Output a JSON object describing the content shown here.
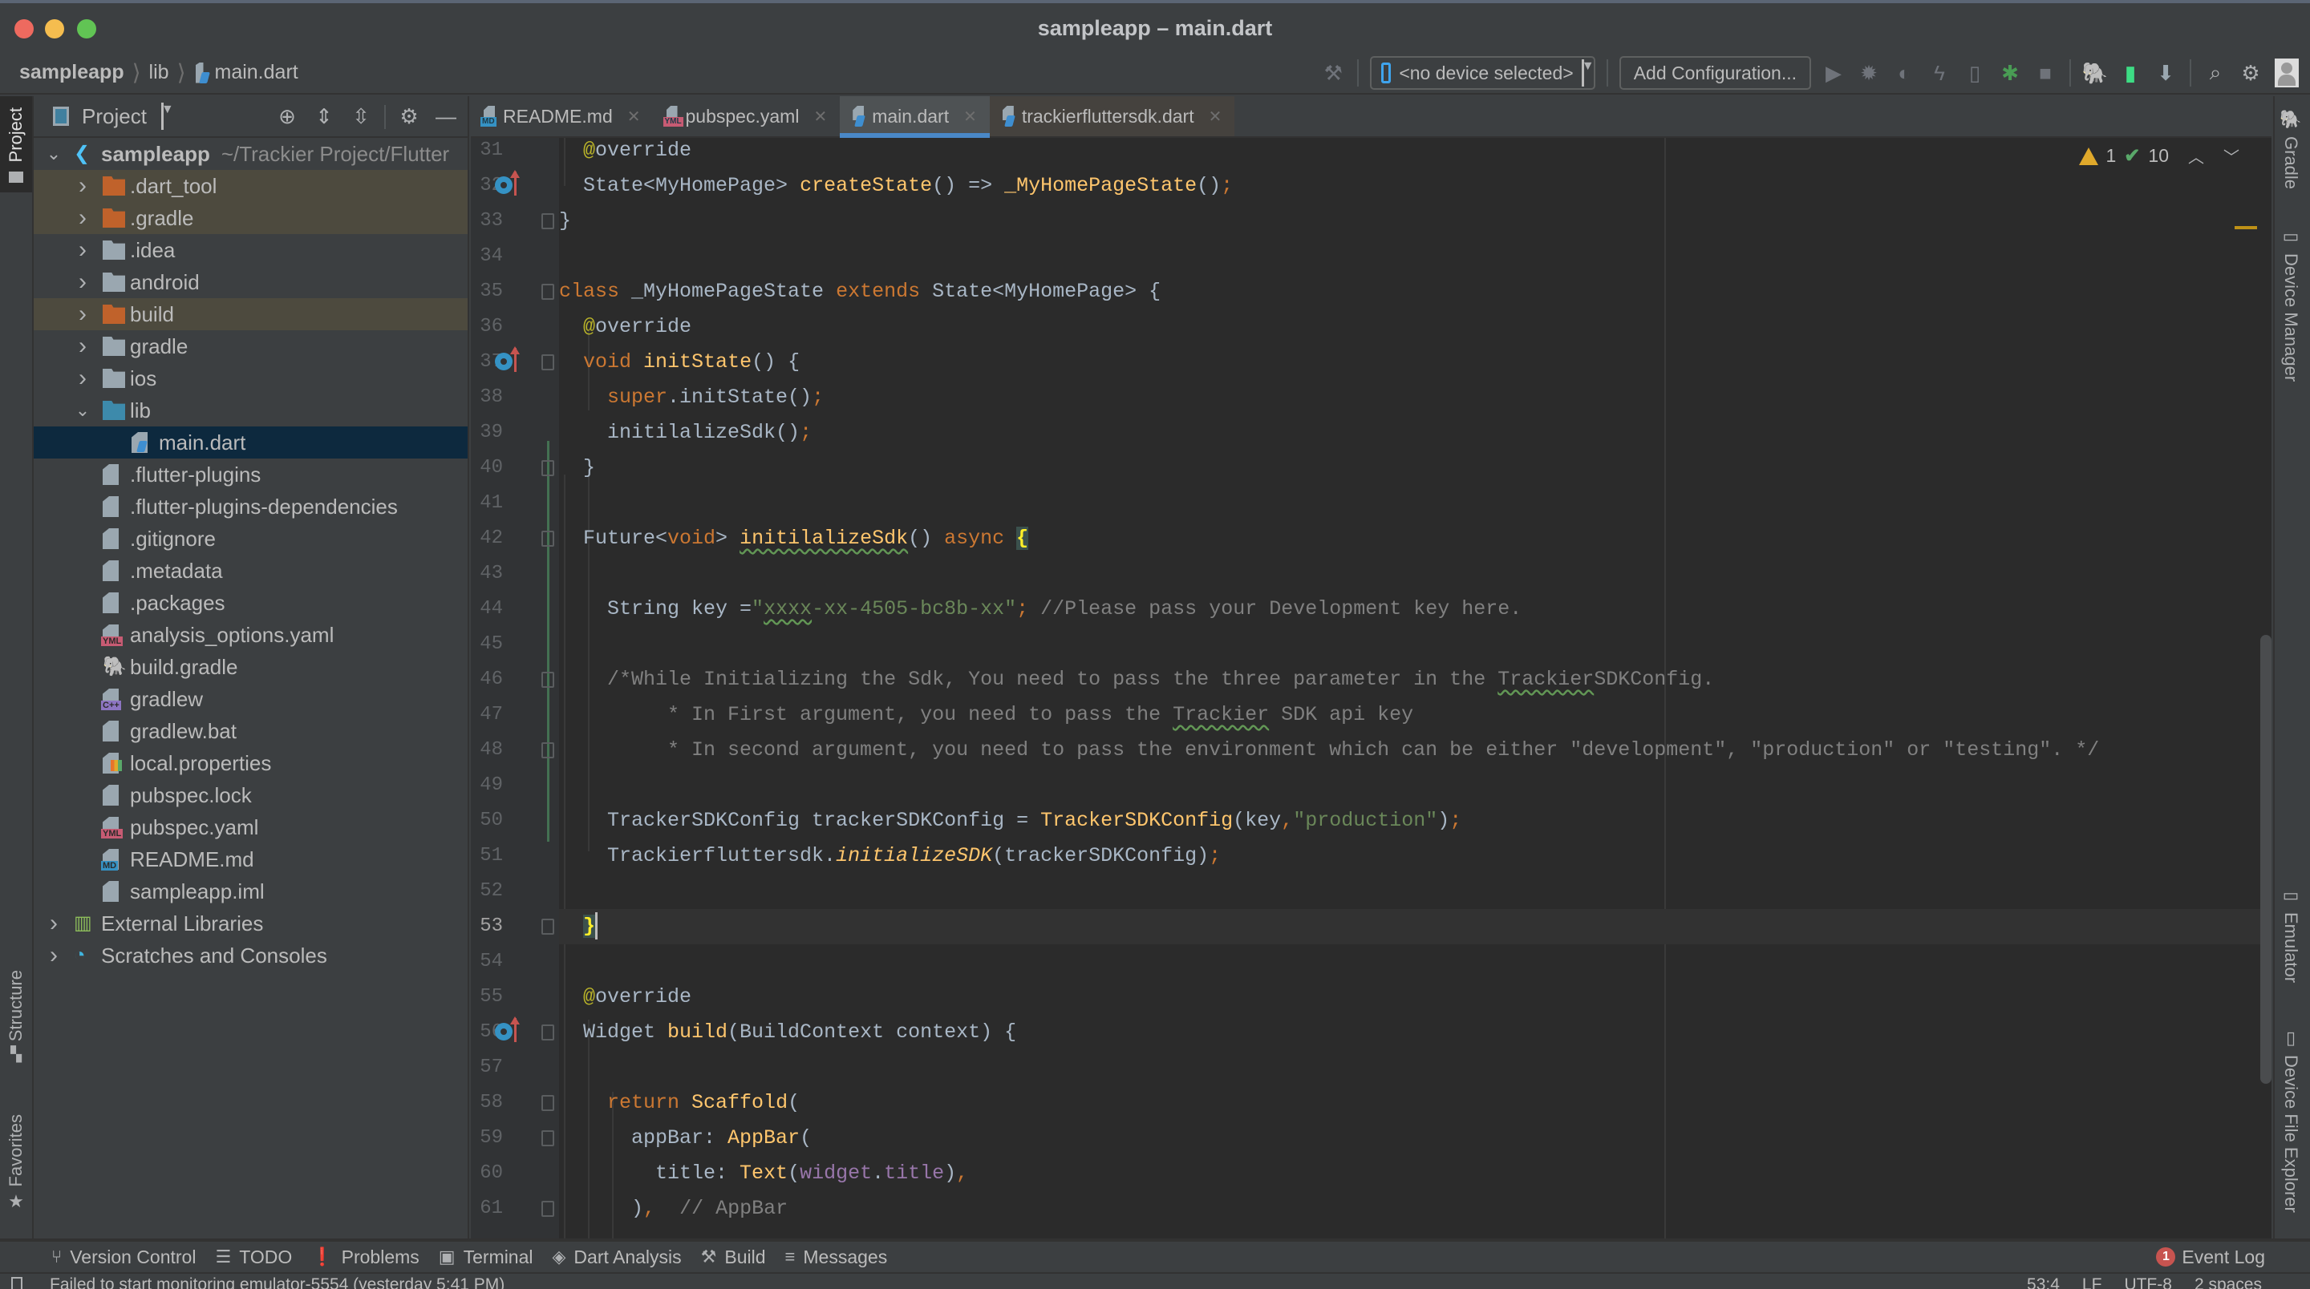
{
  "window": {
    "title": "sampleapp – main.dart"
  },
  "navbar": {
    "breadcrumb": [
      "sampleapp",
      "lib",
      "main.dart"
    ],
    "device_selector": "<no device selected>",
    "add_configuration": "Add Configuration...",
    "toolbar_icons": [
      "hammer-icon",
      "run-icon",
      "debug-icon",
      "profile-icon",
      "apply-changes-icon",
      "attach-debugger-icon",
      "flutter-inspector-icon",
      "stop-icon",
      "gradle-sync-icon",
      "avd-manager-icon",
      "sdk-manager-icon",
      "search-icon",
      "settings-icon",
      "account-icon"
    ]
  },
  "project_panel": {
    "title": "Project",
    "tree": [
      {
        "label": "sampleapp",
        "path": "~/Trackier Project/Flutter",
        "depth": 0,
        "expanded": true,
        "icon": "flutter-icon",
        "bold": true
      },
      {
        "label": ".dart_tool",
        "depth": 1,
        "expanded": false,
        "icon": "folder-excluded",
        "excluded": true
      },
      {
        "label": ".gradle",
        "depth": 1,
        "expanded": false,
        "icon": "folder-excluded",
        "excluded": true
      },
      {
        "label": ".idea",
        "depth": 1,
        "expanded": false,
        "icon": "folder-config"
      },
      {
        "label": "android",
        "depth": 1,
        "expanded": false,
        "icon": "folder-module"
      },
      {
        "label": "build",
        "depth": 1,
        "expanded": false,
        "icon": "folder-excluded-config",
        "excluded": true
      },
      {
        "label": "gradle",
        "depth": 1,
        "expanded": false,
        "icon": "folder"
      },
      {
        "label": "ios",
        "depth": 1,
        "expanded": false,
        "icon": "folder-module"
      },
      {
        "label": "lib",
        "depth": 1,
        "expanded": true,
        "icon": "folder-source"
      },
      {
        "label": "main.dart",
        "depth": 2,
        "icon": "dart-file",
        "selected": true
      },
      {
        "label": ".flutter-plugins",
        "depth": 1,
        "icon": "text-file"
      },
      {
        "label": ".flutter-plugins-dependencies",
        "depth": 1,
        "icon": "text-file"
      },
      {
        "label": ".gitignore",
        "depth": 1,
        "icon": "ignore-file"
      },
      {
        "label": ".metadata",
        "depth": 1,
        "icon": "text-file"
      },
      {
        "label": ".packages",
        "depth": 1,
        "icon": "text-file"
      },
      {
        "label": "analysis_options.yaml",
        "depth": 1,
        "icon": "yaml-file"
      },
      {
        "label": "build.gradle",
        "depth": 1,
        "icon": "gradle-file"
      },
      {
        "label": "gradlew",
        "depth": 1,
        "icon": "cpp-file"
      },
      {
        "label": "gradlew.bat",
        "depth": 1,
        "icon": "text-file"
      },
      {
        "label": "local.properties",
        "depth": 1,
        "icon": "properties-file"
      },
      {
        "label": "pubspec.lock",
        "depth": 1,
        "icon": "text-file"
      },
      {
        "label": "pubspec.yaml",
        "depth": 1,
        "icon": "yaml-file"
      },
      {
        "label": "README.md",
        "depth": 1,
        "icon": "markdown-file"
      },
      {
        "label": "sampleapp.iml",
        "depth": 1,
        "icon": "iml-file"
      },
      {
        "label": "External Libraries",
        "depth": 0,
        "expanded": false,
        "icon": "libraries-icon"
      },
      {
        "label": "Scratches and Consoles",
        "depth": 0,
        "expanded": false,
        "icon": "scratches-icon"
      }
    ]
  },
  "left_strip": {
    "project": "Project",
    "structure": "Structure",
    "favorites": "Favorites"
  },
  "right_strip": {
    "gradle": "Gradle",
    "device_manager": "Device Manager",
    "emulator": "Emulator",
    "device_file_explorer": "Device File Explorer"
  },
  "tabs": [
    {
      "label": "README.md",
      "icon": "markdown-file",
      "badge": "MD",
      "active": false
    },
    {
      "label": "pubspec.yaml",
      "icon": "yaml-file",
      "badge": "YML",
      "active": false
    },
    {
      "label": "main.dart",
      "icon": "dart-file",
      "active": true
    },
    {
      "label": "trackierfluttersdk.dart",
      "icon": "dart-file",
      "active": false,
      "pinned": true
    }
  ],
  "editor": {
    "inspection": {
      "warnings": "1",
      "weak_warnings": "10"
    },
    "cursor_line": 53,
    "lines": [
      {
        "n": "31",
        "code": "  <span class=\"an\">@</span>override"
      },
      {
        "n": "32",
        "code": "  State&lt;MyHomePage&gt; <span class=\"fn\">createState</span>() =&gt; <span class=\"fn\">_MyHomePageState</span>()<span class=\"sc\">;</span>",
        "override": true
      },
      {
        "n": "33",
        "code": "}",
        "fold": true
      },
      {
        "n": "34",
        "code": ""
      },
      {
        "n": "35",
        "code": "<span class=\"kw\">class</span> _MyHomePageState <span class=\"kw\">extends</span> State&lt;MyHomePage&gt; {",
        "fold": true
      },
      {
        "n": "36",
        "code": "  <span class=\"an\">@</span>override"
      },
      {
        "n": "37",
        "code": "  <span class=\"kw\">void</span> <span class=\"fn\">initState</span>() {",
        "override": true,
        "fold": true
      },
      {
        "n": "38",
        "code": "    <span class=\"kw\">super</span>.initState()<span class=\"sc\">;</span>"
      },
      {
        "n": "39",
        "code": "    initilalizeSdk()<span class=\"sc\">;</span>"
      },
      {
        "n": "40",
        "code": "  }",
        "fold": true
      },
      {
        "n": "41",
        "code": ""
      },
      {
        "n": "42",
        "code": "  Future&lt;<span class=\"kw\">void</span>&gt; <span class=\"fn wavy\">initilalizeSdk</span>() <span class=\"kw\">async</span> <span class=\"brace-hl\">{</span>",
        "fold": true
      },
      {
        "n": "43",
        "code": ""
      },
      {
        "n": "44",
        "code": "    String key =<span class=\"st\">\"<span class=\"wavy\">xxxx</span>-xx-4505-bc8b-xx\"</span><span class=\"sc\">;</span> <span class=\"cm\">//Please pass your Development key here.</span>"
      },
      {
        "n": "45",
        "code": ""
      },
      {
        "n": "46",
        "code": "    <span class=\"cm\">/*While Initializing the Sdk, You need to pass the three parameter in the <span class=\"wavy\">Trackier</span>SDKConfig.</span>",
        "fold": true
      },
      {
        "n": "47",
        "code": "<span class=\"cm\">         * In First argument, you need to pass the <span class=\"wavy\">Trackier</span> SDK api key</span>"
      },
      {
        "n": "48",
        "code": "<span class=\"cm\">         * In second argument, you need to pass the environment which can be either \"development\", \"production\" or \"testing\". */</span>",
        "fold": true
      },
      {
        "n": "49",
        "code": ""
      },
      {
        "n": "50",
        "code": "    TrackerSDKConfig trackerSDKConfig = <span class=\"fn\">TrackerSDKConfig</span>(key<span class=\"sc\">,</span><span class=\"st\">\"production\"</span>)<span class=\"sc\">;</span>"
      },
      {
        "n": "51",
        "code": "    Trackierfluttersdk.<span class=\"fn it\">initializeSDK</span>(trackerSDKConfig)<span class=\"sc\">;</span>"
      },
      {
        "n": "52",
        "code": ""
      },
      {
        "n": "53",
        "code": "  <span class=\"brace-hl\">}</span><span class=\"caret\"></span>",
        "fold": true
      },
      {
        "n": "54",
        "code": ""
      },
      {
        "n": "55",
        "code": "  <span class=\"an\">@</span>override"
      },
      {
        "n": "56",
        "code": "  Widget <span class=\"fn\">build</span>(BuildContext context) {",
        "override": true,
        "fold": true
      },
      {
        "n": "57",
        "code": ""
      },
      {
        "n": "58",
        "code": "    <span class=\"kw\">return</span> <span class=\"fn\">Scaffold</span>(",
        "fold": true
      },
      {
        "n": "59",
        "code": "      appBar: <span class=\"fn\">AppBar</span>(",
        "fold": true
      },
      {
        "n": "60",
        "code": "        title: <span class=\"fn\">Text</span>(<span class=\"pr\">widget</span>.<span class=\"pr\">title</span>)<span class=\"sc\">,</span>"
      },
      {
        "n": "61",
        "code": "      )<span class=\"sc\">,</span>  <span class=\"cm\">// AppBar</span>",
        "fold": true
      }
    ]
  },
  "bottom_bar": {
    "items": [
      {
        "label": "Version Control",
        "icon": "version-control-icon"
      },
      {
        "label": "TODO",
        "icon": "todo-icon"
      },
      {
        "label": "Problems",
        "icon": "problems-icon"
      },
      {
        "label": "Terminal",
        "icon": "terminal-icon"
      },
      {
        "label": "Dart Analysis",
        "icon": "dart-analysis-icon"
      },
      {
        "label": "Build",
        "icon": "build-icon"
      },
      {
        "label": "Messages",
        "icon": "messages-icon"
      }
    ],
    "event_log": "Event Log",
    "event_count": "1"
  },
  "status_bar": {
    "message": "Failed to start monitoring emulator-5554 (yesterday 5:41 PM)",
    "position": "53:4",
    "line_separator": "LF",
    "encoding": "UTF-8",
    "indent": "2 spaces"
  }
}
